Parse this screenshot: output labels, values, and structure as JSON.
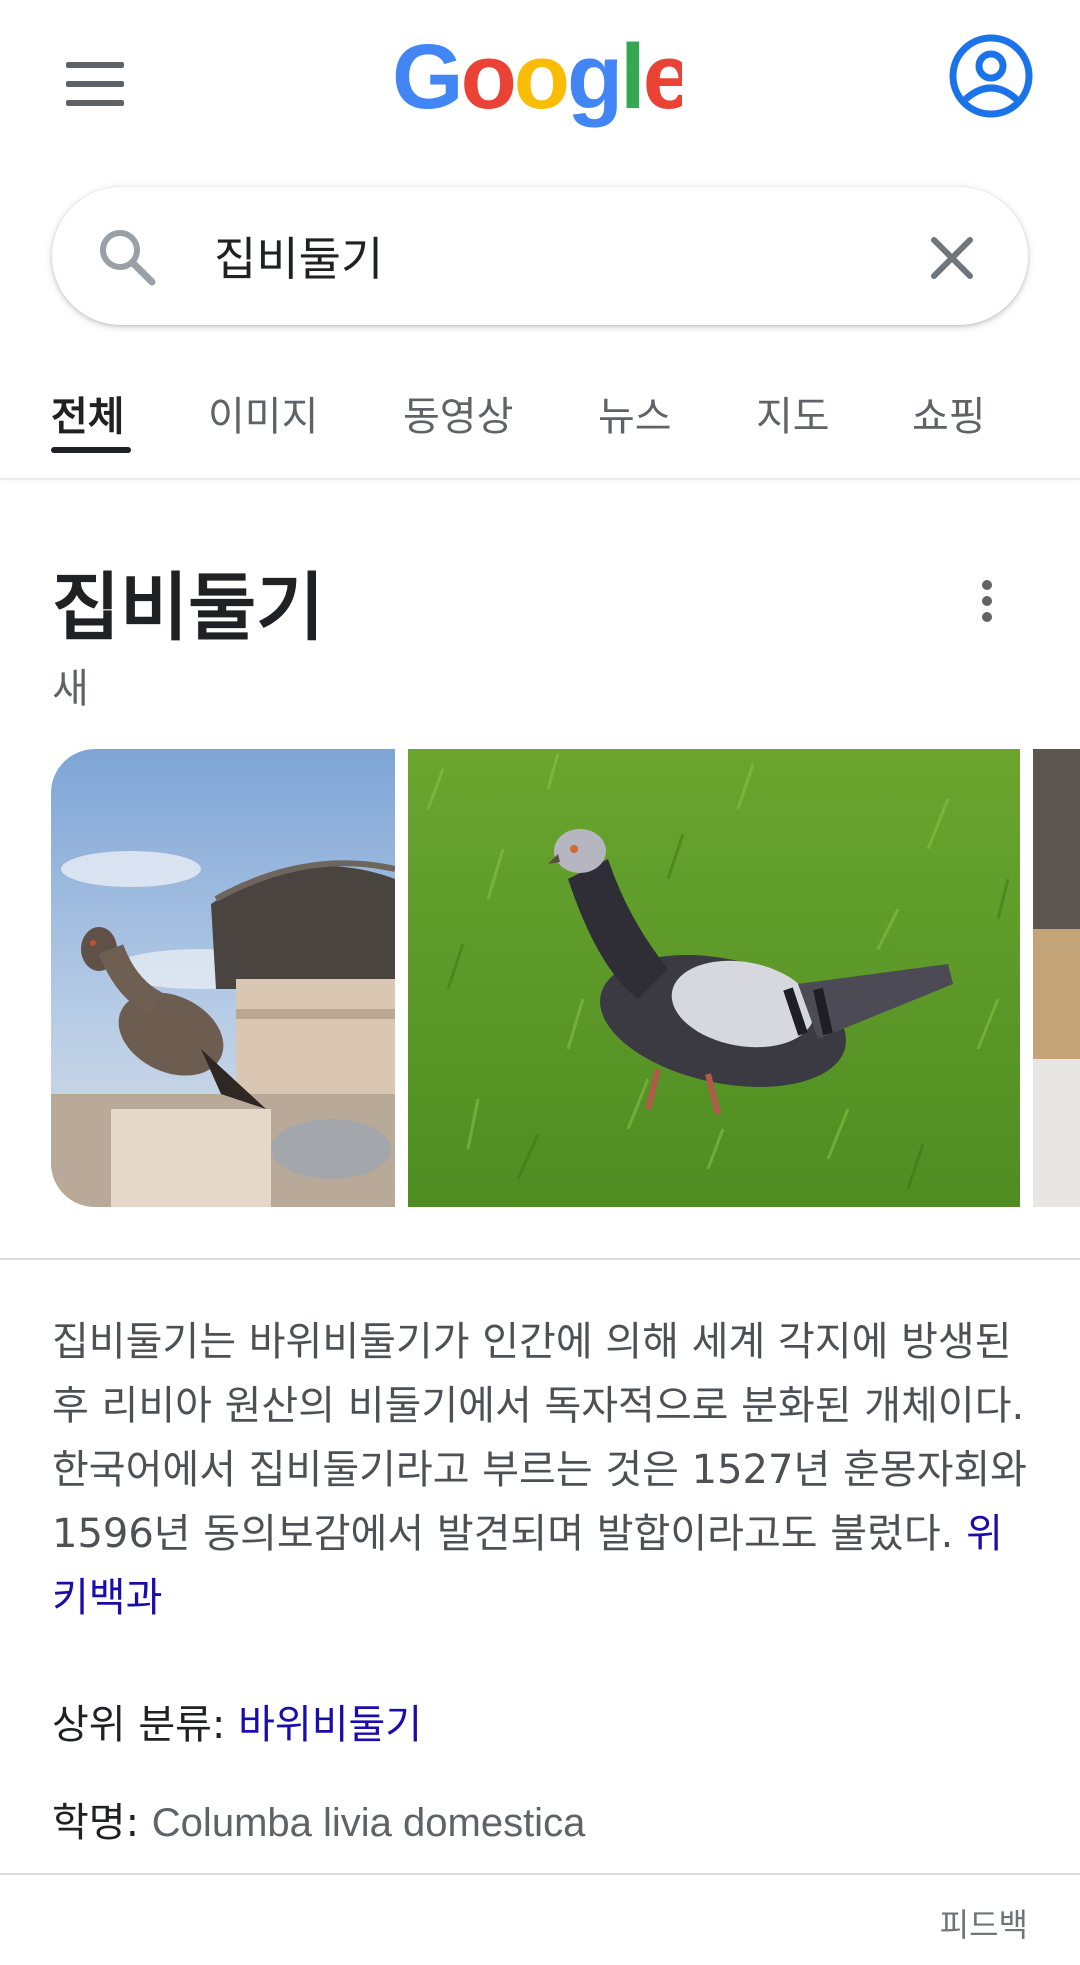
{
  "header": {
    "menu_icon": "hamburger-menu-icon",
    "logo_text": "Google",
    "logo_colors": [
      "#4285F4",
      "#EA4335",
      "#FBBC05",
      "#4285F4",
      "#34A853",
      "#EA4335"
    ],
    "account_icon": "account-circle-icon"
  },
  "search": {
    "query": "집비둘기",
    "search_icon": "search-icon",
    "clear_icon": "close-icon"
  },
  "tabs": [
    {
      "label": "전체",
      "active": true
    },
    {
      "label": "이미지",
      "active": false
    },
    {
      "label": "동영상",
      "active": false
    },
    {
      "label": "뉴스",
      "active": false
    },
    {
      "label": "지도",
      "active": false
    },
    {
      "label": "쇼핑",
      "active": false
    }
  ],
  "knowledge_panel": {
    "title": "집비둘기",
    "subtitle": "새",
    "more_icon": "more-vertical-icon",
    "description": "집비둘기는 바위비둘기가 인간에 의해 세계 각지에 방생된 후 리비아 원산의 비둘기에서 독자적으로 분화된 개체이다. 한국어에서 집비둘기라고 부르는 것은 1527년 훈몽자회와 1596년 동의보감에서 발견되며 발합이라고도 불렀다. ",
    "source_link": "위키백과",
    "facts": [
      {
        "label": "상위 분류: ",
        "value": "바위비둘기",
        "is_link": true
      },
      {
        "label": "학명: ",
        "value": "Columba livia domestica",
        "is_link": false
      }
    ],
    "feedback": "피드백"
  },
  "colors": {
    "link": "#1a0dab",
    "text_primary": "#202124",
    "text_secondary": "#5f6368",
    "google_blue": "#1a73e8"
  }
}
